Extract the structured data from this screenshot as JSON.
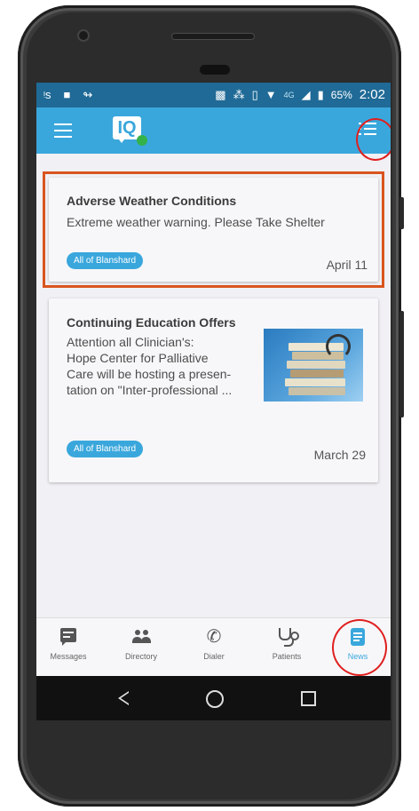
{
  "status_bar": {
    "icons_left": [
      "nfc-icon",
      "android-icon",
      "missed-call-icon"
    ],
    "icons_right": [
      "cast-icon",
      "bluetooth-icon",
      "vibrate-icon",
      "wifi-icon",
      "signal-icon",
      "battery-icon"
    ],
    "network": "4G",
    "battery": "65%",
    "time": "2:02"
  },
  "app_bar": {
    "logo_text": "IQ",
    "colors": {
      "primary": "#3aa7dc",
      "status_bar": "#1f6a96",
      "online": "#34b24a"
    }
  },
  "news": [
    {
      "title": "Adverse Weather Conditions",
      "body": "Extreme weather warning.  Please Take Shelter",
      "tag": "All of Blanshard",
      "date": "April 11",
      "highlighted": true
    },
    {
      "title": "Continuing Education Offers",
      "body_lines": [
        "Attention all Clinician's:",
        "Hope Center for Palliative",
        "Care will be hosting a presen-",
        "tation on \"Inter-professional ..."
      ],
      "tag": "All of Blanshard",
      "date": "March 29",
      "image": "stack-of-books-stethoscope"
    }
  ],
  "bottom_nav": [
    {
      "label": "Messages",
      "icon": "message-icon",
      "active": false
    },
    {
      "label": "Directory",
      "icon": "people-icon",
      "active": false
    },
    {
      "label": "Dialer",
      "icon": "phone-icon",
      "active": false
    },
    {
      "label": "Patients",
      "icon": "stethoscope-icon",
      "active": false
    },
    {
      "label": "News",
      "icon": "news-icon",
      "active": true
    }
  ],
  "annotation_color": "#e01f1f"
}
